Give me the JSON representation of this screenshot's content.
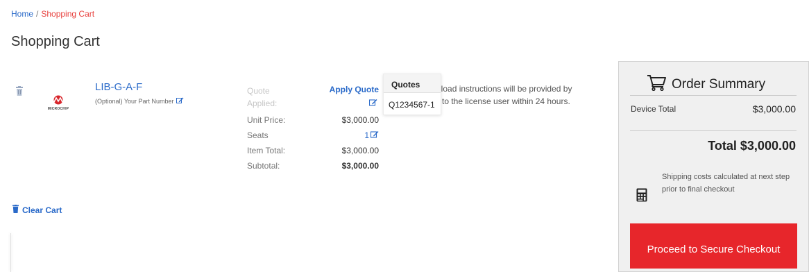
{
  "breadcrumb": {
    "home": "Home",
    "separator": "/",
    "current": "Shopping Cart"
  },
  "page_title": "Shopping Cart",
  "cart_item": {
    "product_name": "LIB-G-A-F",
    "part_number_label": "(Optional) Your Part Number",
    "logo_text": "MICROCHIP",
    "quote_label": "Quote Applied:",
    "apply_quote_label": "Apply Quote",
    "unit_price_label": "Unit Price:",
    "unit_price": "$3,000.00",
    "seats_label": "Seats",
    "seats": "1",
    "item_total_label": "Item Total:",
    "item_total": "$3,000.00",
    "subtotal_label": "Subtotal:",
    "subtotal": "$3,000.00",
    "download_note": "Download instructions will be provided by email to the license user within 24 hours."
  },
  "quotes_popover": {
    "header": "Quotes",
    "items": [
      "Q1234567-1"
    ]
  },
  "clear_cart_label": "Clear Cart",
  "order_summary": {
    "title": "Order Summary",
    "device_total_label": "Device Total",
    "device_total": "$3,000.00",
    "total": "Total $3,000.00",
    "shipping_note": "Shipping costs calculated at next step prior to final checkout",
    "checkout_label": "Proceed to Secure Checkout"
  },
  "colors": {
    "link": "#2a6ac9",
    "accent_red": "#e7262b",
    "breadcrumb_current": "#e8423f",
    "summary_bg": "#f0f0f0"
  },
  "icons": [
    "trash-icon",
    "edit-icon",
    "cart-icon",
    "calculator-icon"
  ]
}
